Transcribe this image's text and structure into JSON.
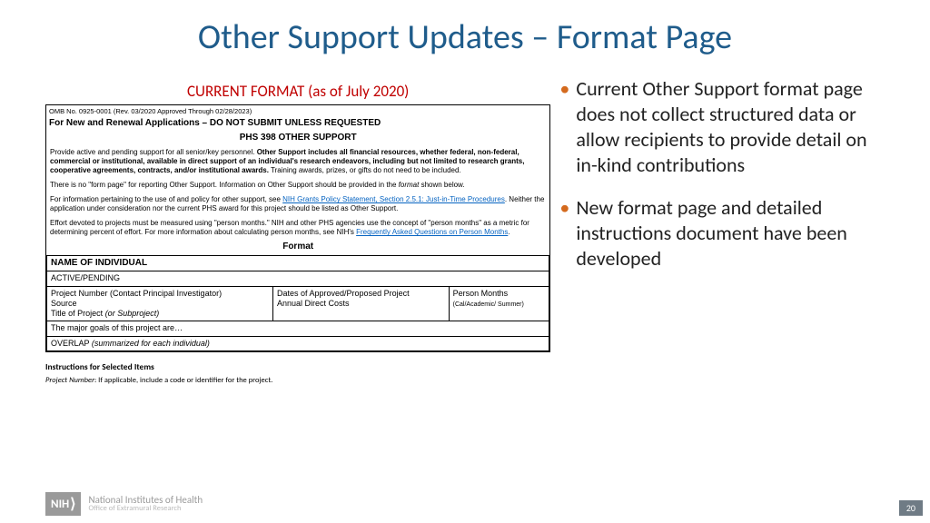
{
  "title": "Other Support Updates – Format Page",
  "current_format_label": "CURRENT FORMAT (as of July 2020)",
  "form": {
    "omb": "OMB No. 0925-0001 (Rev. 03/2020 Approved Through 02/28/2023)",
    "request_line": "For New and Renewal Applications – DO NOT SUBMIT UNLESS REQUESTED",
    "phs_title": "PHS 398 OTHER SUPPORT",
    "p1a": "Provide active and pending support for all senior/key personnel. ",
    "p1b": "Other Support includes all financial resources, whether federal, non-federal, commercial or institutional, available in direct support of an individual's research endeavors, including but not limited to research grants, cooperative agreements, contracts, and/or institutional awards.",
    "p1c": " Training awards, prizes, or gifts do not need to be included.",
    "p2a": "There is no \"form page\" for reporting Other Support. Information on Other Support should be provided in the ",
    "p2b": "format",
    "p2c": " shown below.",
    "p3a": "For information pertaining to the use of and policy for other support, see ",
    "p3link": "NIH Grants Policy Statement, Section 2.5.1: Just-in-Time Procedures",
    "p3b": ". Neither the application under consideration nor the current PHS award for this project should be listed as Other Support.",
    "p4a": "Effort devoted to projects must be measured using \"person months.\" NIH and other PHS agencies use the concept of \"person months\" as a metric for determining percent of effort. For more information about calculating person months, see NIH's ",
    "p4link": "Frequently Asked Questions on Person Months",
    "p4b": ".",
    "format_heading": "Format",
    "table": {
      "name": "NAME OF INDIVIDUAL",
      "active": "ACTIVE/PENDING",
      "c1a": "Project Number (Contact Principal Investigator)",
      "c1b": "Source",
      "c1c": "Title of Project ",
      "c1d": "(or Subproject)",
      "c2a": "Dates of Approved/Proposed Project",
      "c2b": "Annual Direct Costs",
      "c3a": "Person Months",
      "c3b": "(Cal/Academic/ Summer)",
      "goals": "The major goals of this project are…",
      "overlap_a": "OVERLAP ",
      "overlap_b": "(summarized for each individual)"
    },
    "instr_heading": "Instructions for Selected Items",
    "instr_p_a": "Project Number",
    "instr_p_b": ": If applicable, include a code or identifier for the project."
  },
  "bullets": [
    "Current Other Support format page does not collect structured data or allow recipients to provide detail on in-kind contributions",
    "New format page and detailed instructions document have been developed"
  ],
  "footer": {
    "nih": "NIH",
    "line1": "National Institutes of Health",
    "line2": "Office of Extramural Research"
  },
  "page_number": "20"
}
